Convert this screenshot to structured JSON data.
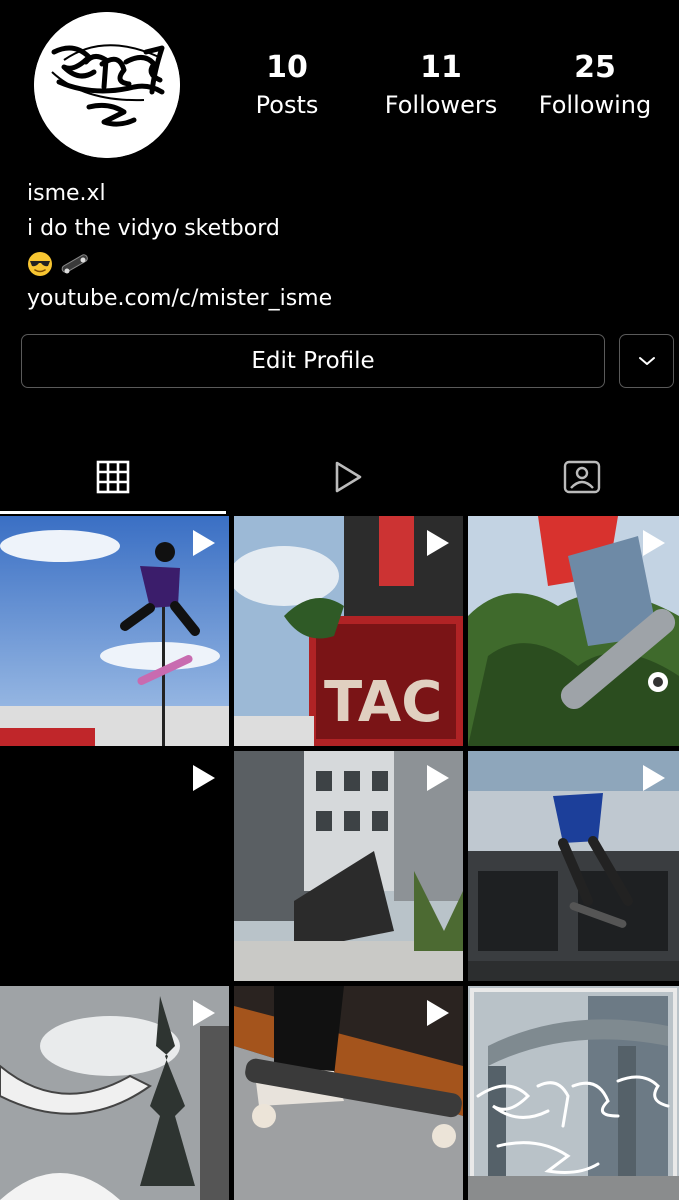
{
  "profile": {
    "avatar_icon": "graffiti-tag-logo",
    "username": "isme.xl",
    "bio_line": "i do the vidyo sketbord",
    "emojis": [
      "sunglasses-emoji",
      "skateboard-emoji"
    ],
    "link": "youtube.com/c/mister_isme"
  },
  "stats": [
    {
      "value": "10",
      "label": "Posts"
    },
    {
      "value": "11",
      "label": "Followers"
    },
    {
      "value": "25",
      "label": "Following"
    }
  ],
  "actions": {
    "edit_profile_label": "Edit Profile",
    "dropdown_icon": "chevron-down-icon"
  },
  "tabs": [
    {
      "icon": "grid-icon",
      "active": true
    },
    {
      "icon": "reels-play-icon",
      "active": false
    },
    {
      "icon": "tagged-person-icon",
      "active": false
    }
  ],
  "posts": [
    {
      "type": "video",
      "scene": "skater-jump-sky"
    },
    {
      "type": "video",
      "scene": "red-sign-rooftop"
    },
    {
      "type": "video",
      "scene": "skater-board-trees"
    },
    {
      "type": "video",
      "scene": "black"
    },
    {
      "type": "video",
      "scene": "stairs-building"
    },
    {
      "type": "video",
      "scene": "skater-building-ledge"
    },
    {
      "type": "video",
      "scene": "rollercoaster-tree"
    },
    {
      "type": "video",
      "scene": "skate-shoe-closeup"
    },
    {
      "type": "image",
      "scene": "embarcadero-graffiti"
    }
  ]
}
